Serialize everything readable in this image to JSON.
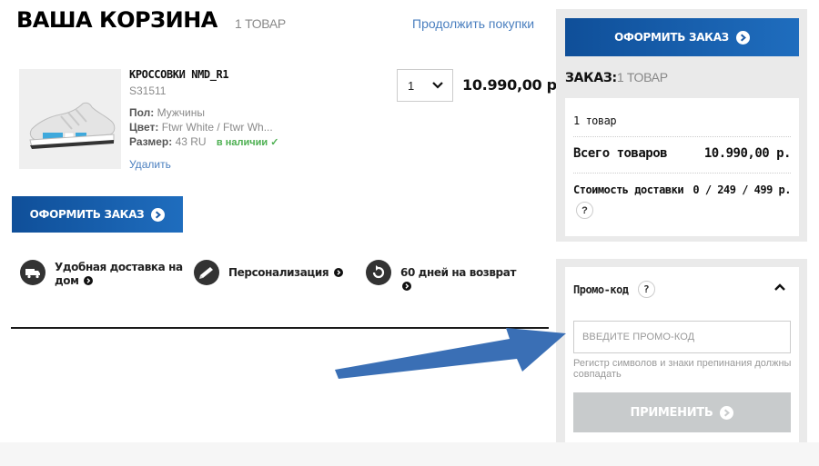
{
  "cart": {
    "title": "ВАША КОРЗИНА",
    "count": "1 ТОВАР",
    "continue_link": "Продолжить покупки"
  },
  "product": {
    "name": "КРОССОВКИ NMD_R1",
    "sku": "S31511",
    "gender_label": "Пол:",
    "gender": "Мужчины",
    "color_label": "Цвет:",
    "color": "Ftwr White / Ftwr Wh...",
    "size_label": "Размер:",
    "size": "43 RU",
    "stock": "в наличии ✓",
    "remove": "Удалить",
    "quantity": "1",
    "price": "10.990,00 р."
  },
  "checkout_button": "ОФОРМИТЬ ЗАКАЗ",
  "benefits": [
    {
      "label": "Удобная доставка на дом",
      "icon": "truck-icon"
    },
    {
      "label": "Персонализация",
      "icon": "personalization-icon"
    },
    {
      "label": "60 дней на возврат",
      "icon": "return-icon"
    }
  ],
  "summary": {
    "title_bold": "ЗАКАЗ:",
    "title_count": "1 ТОВАР",
    "items_count": "1 товар",
    "total_label": "Всего товаров",
    "total_value": "10.990,00 р.",
    "shipping_label": "Стоимость доставки",
    "shipping_value": "0 / 249 / 499 р.",
    "help": "?"
  },
  "promo": {
    "title": "Промо-код",
    "help": "?",
    "placeholder": "ВВЕДИТЕ ПРОМО-КОД",
    "hint": "Регистр символов и знаки препинания должны совпадать",
    "apply_button": "ПРИМЕНИТЬ"
  },
  "colors": {
    "brand_blue": "#1a5aa6",
    "link_blue": "#4a7fbf",
    "stock_green": "#4caf50",
    "disabled_gray": "#c8cbcc",
    "annotation_arrow": "#3a6fb5"
  }
}
